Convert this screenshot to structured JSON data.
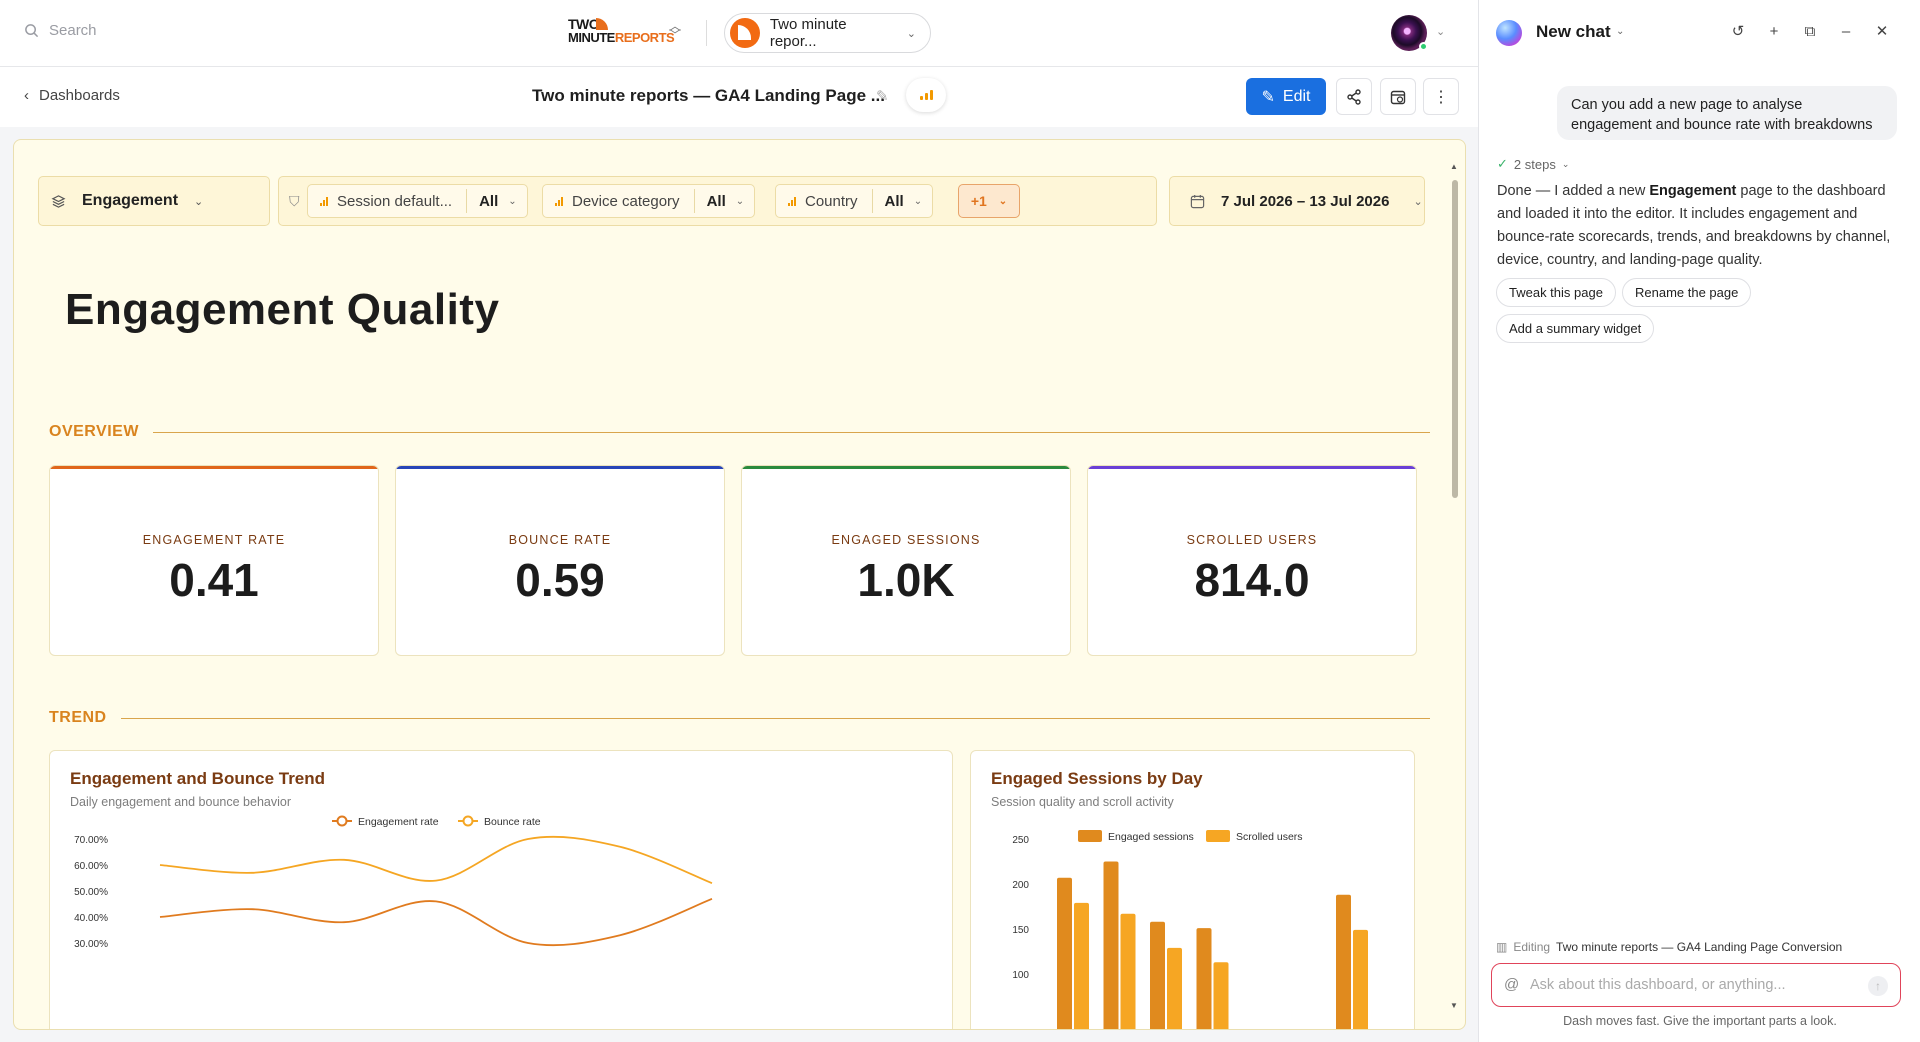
{
  "topbar": {
    "search_placeholder": "Search",
    "logo_line1": "TWO",
    "logo_line2a": "MINUTE",
    "logo_line2b": "REPORTS",
    "account_name": "Two minute repor..."
  },
  "subheader": {
    "back_label": "Dashboards",
    "title": "Two minute reports — GA4 Landing Page ...",
    "edit_label": "Edit"
  },
  "filters": {
    "page": "Engagement",
    "items": [
      {
        "label": "Session default...",
        "value": "All"
      },
      {
        "label": "Device category",
        "value": "All"
      },
      {
        "label": "Country",
        "value": "All"
      }
    ],
    "more": "+1",
    "date_range": "7 Jul 2026 – 13 Jul 2026"
  },
  "page": {
    "title": "Engagement Quality",
    "section_overview": "OVERVIEW",
    "section_trend": "TREND"
  },
  "kpis": [
    {
      "label": "ENGAGEMENT RATE",
      "value": "0.41",
      "color": "#e0661b"
    },
    {
      "label": "BOUNCE RATE",
      "value": "0.59",
      "color": "#2845b8"
    },
    {
      "label": "ENGAGED SESSIONS",
      "value": "1.0K",
      "color": "#2b8a3e"
    },
    {
      "label": "SCROLLED USERS",
      "value": "814.0",
      "color": "#6a3fd6"
    }
  ],
  "colors": {
    "engagement_line": "#e07b1f",
    "bounce_line": "#f5a623",
    "engaged_bar": "#e08a1e",
    "scrolled_bar": "#f6a623"
  },
  "chart_data": [
    {
      "type": "line",
      "title": "Engagement and Bounce Trend",
      "subtitle": "Daily engagement and bounce behavior",
      "y_ticks": [
        "70.00%",
        "60.00%",
        "50.00%",
        "40.00%",
        "30.00%"
      ],
      "ylim": [
        0.3,
        0.7
      ],
      "legend": "top-center",
      "series": [
        {
          "name": "Engagement rate",
          "values": [
            0.4,
            0.43,
            0.38,
            0.46,
            0.3,
            0.33,
            0.47
          ]
        },
        {
          "name": "Bounce rate",
          "values": [
            0.6,
            0.57,
            0.62,
            0.54,
            0.7,
            0.67,
            0.53
          ]
        }
      ]
    },
    {
      "type": "bar",
      "title": "Engaged Sessions by Day",
      "subtitle": "Session quality and scroll activity",
      "y_ticks": [
        "250",
        "200",
        "150",
        "100"
      ],
      "ylim": [
        100,
        250
      ],
      "legend": "top-center",
      "series": [
        {
          "name": "Engaged sessions",
          "values": [
            207,
            225,
            158,
            151,
            0,
            0,
            188
          ]
        },
        {
          "name": "Scrolled users",
          "values": [
            179,
            167,
            129,
            113,
            0,
            0,
            149
          ]
        }
      ]
    }
  ],
  "chat": {
    "title": "New chat",
    "user_message": "Can you add a new page to analyse engagement and bounce rate with breakdowns",
    "steps": "2 steps",
    "reply_a": "Done — I added a new ",
    "reply_b": "Engagement",
    "reply_c": " page to the dashboard and loaded it into the editor. It includes engagement and bounce-rate scorecards, trends, and breakdowns by channel, device, country, and landing-page quality.",
    "suggestions": [
      "Tweak this page",
      "Rename the page",
      "Add a summary widget"
    ],
    "editing_prefix": "Editing",
    "editing_name": "Two minute reports — GA4 Landing Page Conversion",
    "input_placeholder": "Ask about this dashboard, or anything...",
    "footnote": "Dash moves fast. Give the important parts a look."
  }
}
